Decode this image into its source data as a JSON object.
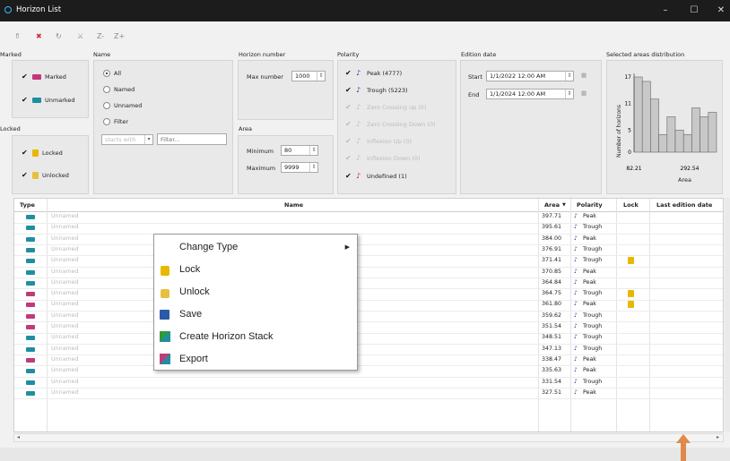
{
  "window": {
    "title": "Horizon List",
    "min_label": "–",
    "max_label": "☐",
    "close_label": "✕"
  },
  "toolbar": {
    "items": [
      "⇑",
      "✖",
      "↻",
      "⚔",
      "Z-",
      "Z+"
    ]
  },
  "filters": {
    "marked": {
      "label": "Marked",
      "items": [
        {
          "label": "Marked",
          "checked": true
        },
        {
          "label": "Unmarked",
          "checked": true
        }
      ]
    },
    "locked": {
      "label": "Locked",
      "items": [
        {
          "label": "Locked",
          "checked": true
        },
        {
          "label": "Unlocked",
          "checked": true
        }
      ]
    },
    "name": {
      "label": "Name",
      "options": [
        "All",
        "Named",
        "Unnamed",
        "Filter"
      ],
      "selected": "All",
      "mode": "starts with",
      "filter_placeholder": "Filter..."
    },
    "horizon_number": {
      "label": "Horizon number",
      "max_label": "Max number",
      "max_value": "1000"
    },
    "area": {
      "label": "Area",
      "min_label": "Minimum",
      "min_value": "80",
      "max_label": "Maximum",
      "max_value": "9999"
    },
    "polarity": {
      "label": "Polarity",
      "items": [
        {
          "label": "Peak (4777)",
          "checked": true,
          "enabled": true
        },
        {
          "label": "Trough (5223)",
          "checked": true,
          "enabled": true
        },
        {
          "label": "Zero Crossing up (0)",
          "checked": true,
          "enabled": false
        },
        {
          "label": "Zero Crossing Down (0)",
          "checked": true,
          "enabled": false
        },
        {
          "label": "Inflexion Up (0)",
          "checked": true,
          "enabled": false
        },
        {
          "label": "Inflexion Down (0)",
          "checked": true,
          "enabled": false
        },
        {
          "label": "Undefined (1)",
          "checked": true,
          "enabled": true
        }
      ]
    },
    "edition_date": {
      "label": "Edition date",
      "start_label": "Start",
      "start_value": "1/1/2022 12:00 AM",
      "end_label": "End",
      "end_value": "1/1/2024 12:00 AM"
    },
    "distribution": {
      "label": "Selected areas distribution"
    }
  },
  "chart_data": {
    "type": "bar",
    "title": "",
    "xlabel": "Area",
    "ylabel": "Number of horizons",
    "x_tick_labels": [
      "82.21",
      "292.54"
    ],
    "y_tick_labels": [
      "0",
      "5",
      "11",
      "17"
    ],
    "ylim": [
      0,
      17
    ],
    "values": [
      17,
      16,
      12,
      4,
      8,
      5,
      4,
      10,
      8,
      9
    ]
  },
  "table": {
    "columns": [
      "Type",
      "Name",
      "Area",
      "Polarity",
      "Lock",
      "Last edition date"
    ],
    "sort_indicator": "▼",
    "rows": [
      {
        "name": "Unnamed",
        "area": "397.71",
        "polarity": "Peak",
        "locked": false
      },
      {
        "name": "Unnamed",
        "area": "395.61",
        "polarity": "Trough",
        "locked": false
      },
      {
        "name": "Unnamed",
        "area": "384.00",
        "polarity": "Peak",
        "locked": false
      },
      {
        "name": "Unnamed",
        "area": "376.91",
        "polarity": "Trough",
        "locked": false
      },
      {
        "name": "Unnamed",
        "area": "371.41",
        "polarity": "Trough",
        "locked": true
      },
      {
        "name": "Unnamed",
        "area": "370.85",
        "polarity": "Peak",
        "locked": false
      },
      {
        "name": "Unnamed",
        "area": "364.84",
        "polarity": "Peak",
        "locked": false
      },
      {
        "name": "Unnamed",
        "area": "364.75",
        "polarity": "Trough",
        "locked": true
      },
      {
        "name": "Unnamed",
        "area": "361.80",
        "polarity": "Peak",
        "locked": true
      },
      {
        "name": "Unnamed",
        "area": "359.62",
        "polarity": "Trough",
        "locked": false
      },
      {
        "name": "Unnamed",
        "area": "351.54",
        "polarity": "Trough",
        "locked": false
      },
      {
        "name": "Unnamed",
        "area": "348.51",
        "polarity": "Trough",
        "locked": false
      },
      {
        "name": "Unnamed",
        "area": "347.13",
        "polarity": "Trough",
        "locked": false
      },
      {
        "name": "Unnamed",
        "area": "338.47",
        "polarity": "Peak",
        "locked": false
      },
      {
        "name": "Unnamed",
        "area": "335.63",
        "polarity": "Peak",
        "locked": false
      },
      {
        "name": "Unnamed",
        "area": "331.54",
        "polarity": "Trough",
        "locked": false
      },
      {
        "name": "Unnamed",
        "area": "327.51",
        "polarity": "Peak",
        "locked": false
      }
    ],
    "row_type_colors": [
      "#1f8fa0",
      "#1f8fa0",
      "#1f8fa0",
      "#1f8fa0",
      "#1f8fa0",
      "#1f8fa0",
      "#1f8fa0",
      "#c03a7a",
      "#c03a7a",
      "#c03a7a",
      "#c03a7a",
      "#1f8fa0",
      "#1f8fa0",
      "#c03a7a",
      "#1f8fa0",
      "#1f8fa0",
      "#1f8fa0"
    ]
  },
  "context_menu": {
    "items": [
      {
        "label": "Change Type",
        "submenu": true,
        "icon": "none"
      },
      {
        "label": "Lock",
        "icon": "lock-icon"
      },
      {
        "label": "Unlock",
        "icon": "unlock-icon"
      },
      {
        "label": "Save",
        "icon": "save-icon"
      },
      {
        "label": "Create Horizon Stack",
        "icon": "stack-icon"
      },
      {
        "label": "Export",
        "icon": "export-icon"
      }
    ]
  },
  "colors": {
    "accent": "#3ab8ff",
    "lock": "#e8b800",
    "arrow": "#e08a4a"
  }
}
